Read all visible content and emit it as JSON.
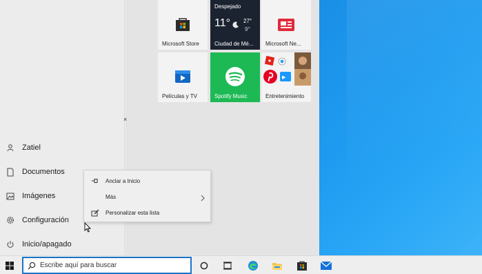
{
  "start_menu": {
    "left_items": [
      {
        "label": "Zatiel",
        "icon": "user-icon"
      },
      {
        "label": "Documentos",
        "icon": "document-icon"
      },
      {
        "label": "Imágenes",
        "icon": "pictures-icon"
      },
      {
        "label": "Configuración",
        "icon": "gear-icon"
      },
      {
        "label": "Inicio/apagado",
        "icon": "power-icon"
      }
    ],
    "tiles": {
      "store": "Microsoft Store",
      "weather": {
        "condition": "Despejado",
        "temp": "11°",
        "high": "27°",
        "low": "9°",
        "city": "Ciudad de Mé..."
      },
      "news": "Microsoft Ne...",
      "movies": "Películas y TV",
      "spotify": "Spotify Music",
      "entertainment": "Entretenimiento"
    }
  },
  "context_menu": {
    "items": [
      {
        "label": "Anclar a Inicio",
        "icon": "pin-icon"
      },
      {
        "label": "Más",
        "icon": ""
      },
      {
        "label": "Personalizar esta lista",
        "icon": "edit-list-icon"
      }
    ]
  },
  "taskbar": {
    "search_placeholder": "Escribe aquí para buscar"
  },
  "colors": {
    "accent": "#1a73c9",
    "spotify": "#1db954",
    "desktop": "#1e9bf0"
  }
}
